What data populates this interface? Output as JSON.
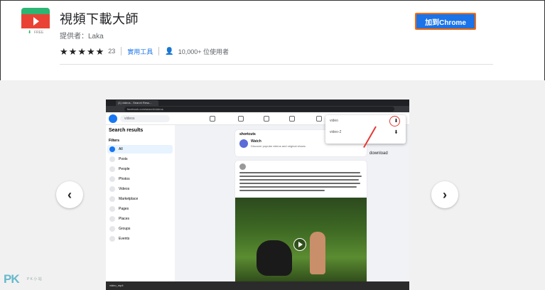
{
  "extension": {
    "title": "視頻下載大師",
    "offered_by_label": "提供者：",
    "offered_by": "Laka",
    "rating_count": "23",
    "category": "實用工具",
    "users": "10,000+ 位使用者",
    "add_button": "加到Chrome",
    "icon_badge": "FREE",
    "stars": 5
  },
  "screenshot": {
    "tab_title": "(1) videos - Search Resu...",
    "url": "facebook.com/search/videos",
    "search_value": "videos",
    "search_results_title": "Search results",
    "filters_label": "Filters",
    "filters": [
      "All",
      "Posts",
      "People",
      "Photos",
      "Videos",
      "Marketplace",
      "Pages",
      "Places",
      "Groups",
      "Events"
    ],
    "shortcuts_heading": "shortcuts",
    "watch_title": "Watch",
    "watch_subtitle": "Discover popular videos and original shows",
    "popup_rows": [
      "video",
      "video-2"
    ],
    "download_label": "download",
    "download_file": "video_mp4"
  },
  "watermark": {
    "text": "PK",
    "sub": "P K 小 站"
  },
  "colors": {
    "accent": "#1a73e8",
    "button_outline": "#ff6a00",
    "icon_red": "#e94235",
    "icon_green": "#2bb673"
  },
  "icons": {
    "prev": "chevron-left-icon",
    "next": "chevron-right-icon",
    "users": "person-icon",
    "download": "download-arrow-icon"
  }
}
